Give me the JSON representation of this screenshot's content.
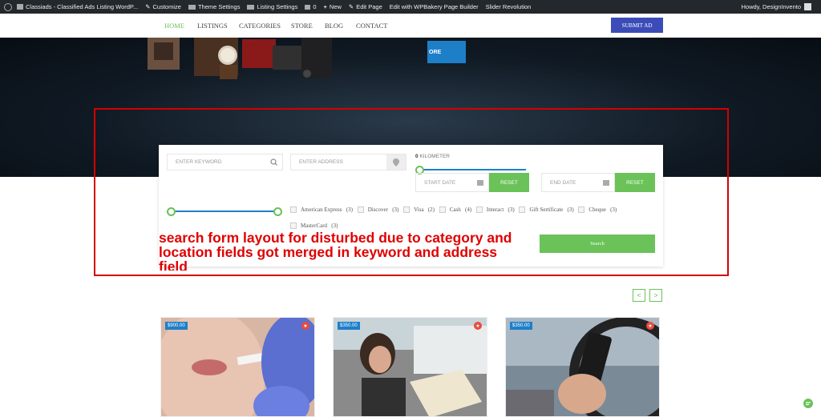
{
  "admin_bar": {
    "site_title": "Classiads - Classified Ads Listing WordP...",
    "customize": "Customize",
    "theme_settings": "Theme Settings",
    "listing_settings": "Listing Settings",
    "comments_count": "0",
    "new_label": "New",
    "edit_page": "Edit Page",
    "wpbakery": "Edit with WPBakery Page Builder",
    "slider": "Slider Revolution",
    "howdy": "Howdy, DesignInvento"
  },
  "nav": {
    "items": [
      "HOME",
      "LISTINGS",
      "CATEGORIES",
      "STORE",
      "BLOG",
      "CONTACT"
    ],
    "submit_ad": "SUBMIT AD"
  },
  "hero": {
    "button_partial": "ORE"
  },
  "search_form": {
    "keyword_placeholder": "ENTER KEYWORD",
    "address_placeholder": "ENTER ADDRESS",
    "km_value": "0",
    "km_label": "KILOMETER",
    "start_date": "START DATE",
    "end_date": "END DATE",
    "reset": "RESET",
    "payment_methods": [
      {
        "label": "American Express",
        "count": "(3)"
      },
      {
        "label": "Discover",
        "count": "(3)"
      },
      {
        "label": "Visa",
        "count": "(2)"
      },
      {
        "label": "Cash",
        "count": "(4)"
      },
      {
        "label": "Interact",
        "count": "(3)"
      },
      {
        "label": "Gift Sertificate",
        "count": "(3)"
      },
      {
        "label": "Cheque",
        "count": "(3)"
      },
      {
        "label": "MasterCard",
        "count": "(3)"
      }
    ],
    "search_button": "Search"
  },
  "annotation": {
    "text": "search form layout for disturbed due to category and location fields got merged in keyword and address field"
  },
  "carousel": {
    "prev": "<",
    "next": ">"
  },
  "listings": [
    {
      "price": "$900.00"
    },
    {
      "price": "$350.00"
    },
    {
      "price": "$350.00"
    }
  ],
  "colors": {
    "accent_green": "#6ac259",
    "accent_blue": "#1e7fc9",
    "submit_blue": "#3b4cb8",
    "annotation_red": "#d40000",
    "admin_bar": "#23282d"
  }
}
